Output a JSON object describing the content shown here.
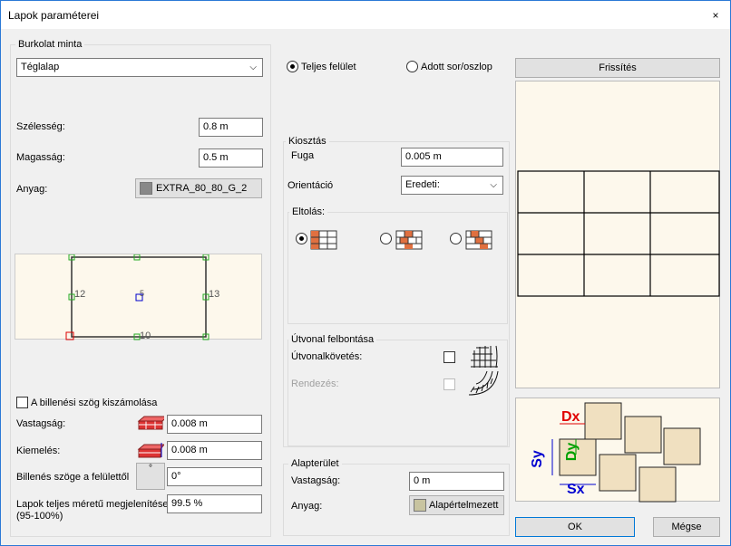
{
  "window": {
    "title": "Lapok paraméterei",
    "close_glyph": "×"
  },
  "left": {
    "group_label": "Burkolat minta",
    "pattern_select": "Téglalap",
    "width_label": "Szélesség:",
    "width_value": "0.8 m",
    "height_label": "Magasság:",
    "height_value": "0.5 m",
    "material_label": "Anyag:",
    "material_value": "EXTRA_80_80_G_2",
    "preview_labels": [
      "12",
      "5",
      "13",
      "10"
    ],
    "tilt_check_label": "A billenési szög kiszámolása",
    "thickness_label": "Vastagság:",
    "thickness_value": "0.008 m",
    "raise_label": "Kiemelés:",
    "raise_value": "0.008 m",
    "tilt_angle_label": "Billenés szöge a felülettől",
    "tilt_angle_value": "0°",
    "tilt_angle_icon": "°",
    "display_label_1": "Lapok teljes méretű megjelenítése",
    "display_label_2": "(95-100%)",
    "display_value": "99.5 %"
  },
  "middle": {
    "radio_full": "Teljes felület",
    "radio_row": "Adott sor/oszlop",
    "layout_group": "Kiosztás",
    "joint_label": "Fuga",
    "joint_value": "0.005 m",
    "orientation_label": "Orientáció",
    "orientation_value": "Eredeti:",
    "offset_group": "Eltolás:",
    "route_group": "Útvonal felbontása",
    "route_follow_label": "Útvonalkövetés:",
    "arrange_label": "Rendezés:",
    "base_group": "Alapterület",
    "base_thickness_label": "Vastagság:",
    "base_thickness_value": "0 m",
    "base_material_label": "Anyag:",
    "base_material_value": "Alapértelmezett"
  },
  "right": {
    "refresh_button": "Frissítés",
    "diagram_labels": {
      "dx": "Dx",
      "dy": "Dy",
      "sx": "Sx",
      "sy": "Sy"
    },
    "ok_button": "OK",
    "cancel_button": "Mégse"
  },
  "colors": {
    "tile_bg": "#fdf8ec",
    "dx": "#e00000",
    "dy": "#00a000",
    "s": "#0000d0",
    "accent": "#0078d7"
  }
}
